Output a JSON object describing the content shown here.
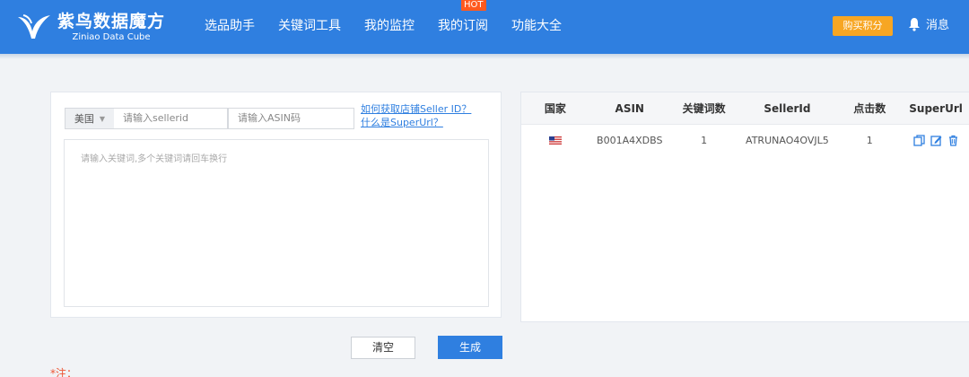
{
  "header": {
    "logo_cn": "紫鸟数据魔方",
    "logo_en": "Ziniao Data Cube",
    "nav": [
      {
        "label": "选品助手"
      },
      {
        "label": "关键词工具"
      },
      {
        "label": "我的监控"
      },
      {
        "label": "我的订阅",
        "badge": "HOT"
      },
      {
        "label": "功能大全"
      }
    ],
    "buy_points": "购买积分",
    "messages": "消息"
  },
  "form": {
    "country": "美国",
    "sellerid_placeholder": "请输入sellerid",
    "asin_placeholder": "请输入ASIN码",
    "help_link_1": "如何获取店铺Seller ID？",
    "help_link_2": "什么是SuperUrl？",
    "keyword_placeholder": "请输入关键词,多个关键词请回车换行",
    "clear_label": "清空",
    "generate_label": "生成",
    "note": "*注："
  },
  "table": {
    "headers": [
      "国家",
      "ASIN",
      "关键词数",
      "SellerId",
      "点击数",
      "SuperUrl"
    ],
    "rows": [
      {
        "country_flag": "us-flag-icon",
        "asin": "B001A4XDBS",
        "keyword_count": "1",
        "seller_id": "ATRUNAO4OVJL5",
        "clicks": "1"
      }
    ]
  },
  "colors": {
    "brand": "#2f7fe0",
    "accent": "#f7a623",
    "hot": "#ff5a1f"
  }
}
